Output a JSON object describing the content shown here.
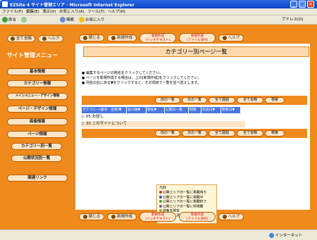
{
  "window": {
    "title": "EZSite 4 サイト管理エリア - Microsoft Internet Explorer"
  },
  "menubar": [
    "ファイル(F)",
    "編集(E)",
    "表示(V)",
    "お気に入り(A)",
    "ツール(T)",
    "ヘルプ(H)"
  ],
  "toolbar": {
    "back": "戻る",
    "search": "検索",
    "favorites": "お気に入り",
    "address_label": "アドレス(D)"
  },
  "sidebar": {
    "top_buttons": {
      "close_all": "全て省略",
      "help": "ヘルプ"
    },
    "heading": "サイト管理メニュー",
    "items": [
      "基本情報",
      "カテゴリー情報",
      "メインメニュー・デザイン情報",
      "ページ・デザイン情報",
      "画像情報",
      "ページ情報"
    ],
    "subitems": [
      "カテゴリー別一覧",
      "公開状況別一覧"
    ],
    "links": [
      "関連リンク"
    ]
  },
  "actions": {
    "close": "閉じる",
    "new": "新規作成",
    "new_rich": "新規作成\n(リッチテキスト)",
    "new_file": "新規作成\n(ファイル添付)",
    "help": "ヘルプ"
  },
  "page_title": "カテゴリー別ページ一覧",
  "instructions": [
    "編集するページの題名をクリックしてください。",
    "ページを新規作成する場合は、上の[新規作成]をクリックしてください。",
    "列名の右にある▼をクリックすると、その項目で一覧を並べ替えします。"
  ],
  "nav": {
    "prev": "前の一覧",
    "next": "次の一覧",
    "expand_all": "全て展開",
    "collapse_all": "全て省略",
    "search": "検索"
  },
  "table": {
    "headers": [
      "カテゴリー(番号　名称)▼",
      "並び順▼",
      "題名▼",
      "公開日一覧",
      "制限",
      "作成日▼",
      "更新日▼"
    ],
    "rows": [
      "05 お試し",
      "30 このサイトについて"
    ]
  },
  "legend": {
    "title": "凡例",
    "items": [
      {
        "label": "公開エリアの一覧に掲載待ち",
        "color": "#c04030"
      },
      {
        "label": "公開エリアの一覧に掲載中",
        "color": "#3050c0"
      },
      {
        "label": "公開エリアの一覧に掲載終了",
        "color": "#40a040"
      },
      {
        "label": "公開エリアの一覧に非掲載",
        "color": "#8050a0"
      },
      {
        "label": "読者を限定",
        "color": "#b0a040"
      },
      {
        "label": "ファイル添付専用ページ",
        "color": "#e0e0e0"
      }
    ]
  },
  "status": {
    "zone": "インターネット"
  }
}
